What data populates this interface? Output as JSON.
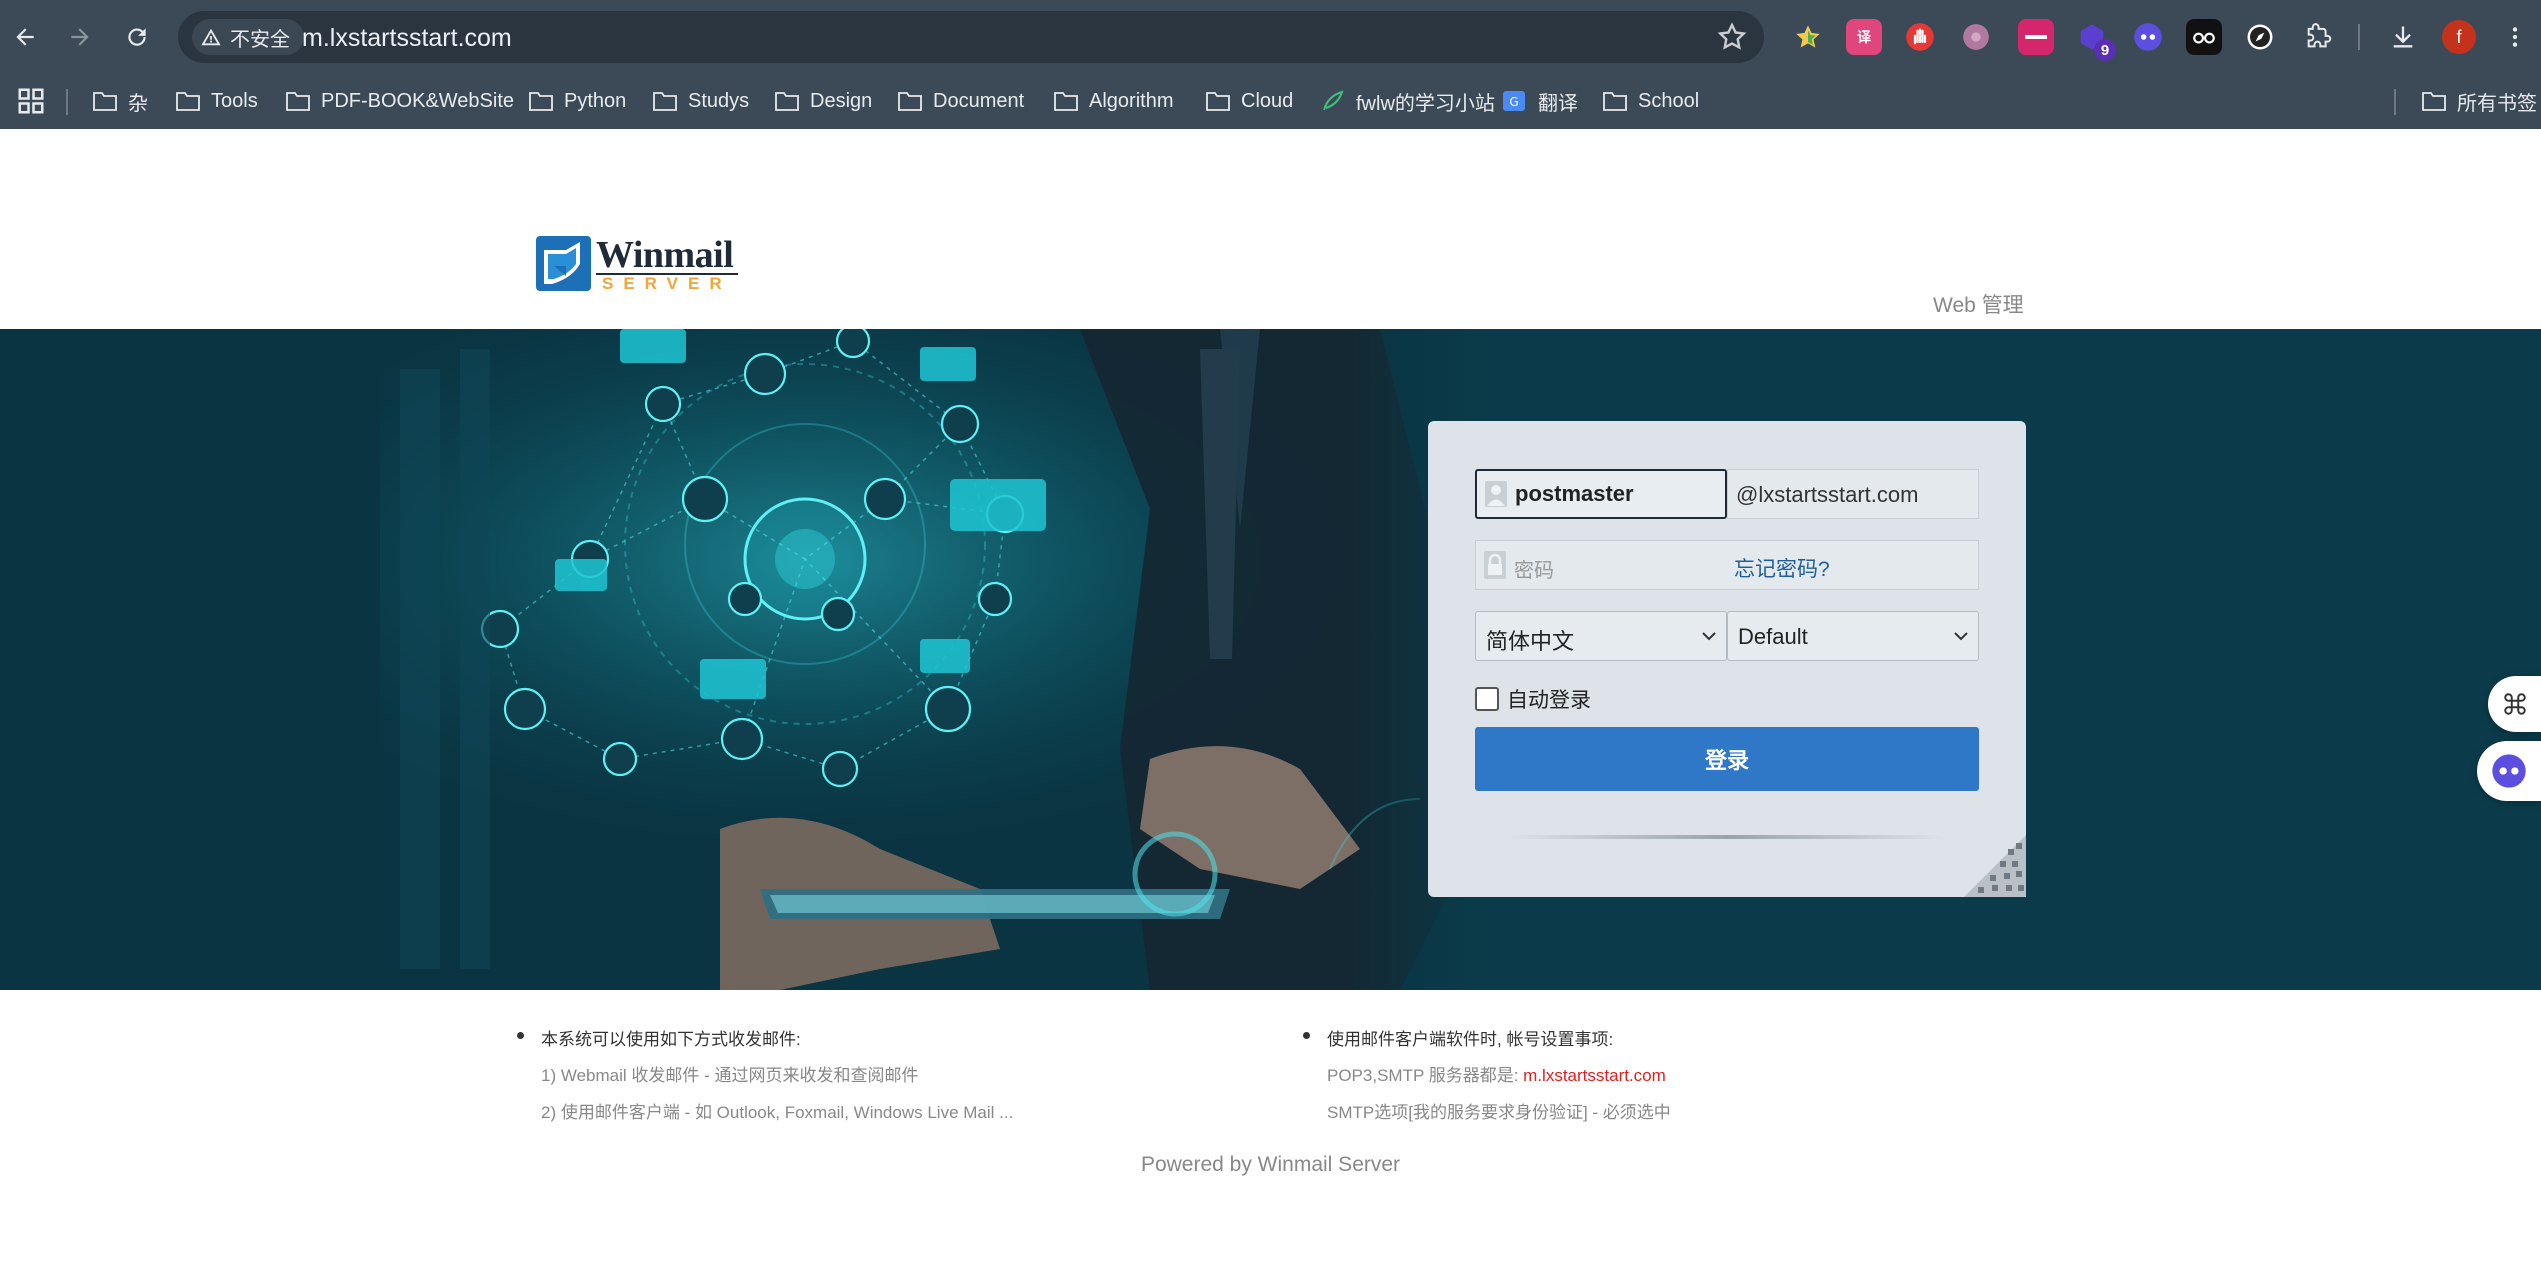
{
  "browser": {
    "security_label": "不安全",
    "url": "m.lxstartsstart.com",
    "profile_initial": "f",
    "extension_badge": "9"
  },
  "bookmarks": [
    {
      "label": "杂",
      "icon": "folder-icon"
    },
    {
      "label": "Tools",
      "icon": "folder-icon"
    },
    {
      "label": "PDF-BOOK&WebSite",
      "icon": "folder-icon"
    },
    {
      "label": "Python",
      "icon": "folder-icon"
    },
    {
      "label": "Studys",
      "icon": "folder-icon"
    },
    {
      "label": "Design",
      "icon": "folder-icon"
    },
    {
      "label": "Document",
      "icon": "folder-icon"
    },
    {
      "label": "Algorithm",
      "icon": "folder-icon"
    },
    {
      "label": "Cloud",
      "icon": "folder-icon"
    },
    {
      "label": "fwlw的学习小站",
      "icon": "feather-icon"
    },
    {
      "label": "翻译",
      "icon": "translate-icon"
    },
    {
      "label": "School",
      "icon": "folder-icon"
    }
  ],
  "all_bookmarks_label": "所有书签",
  "header": {
    "logo_word": "Winmail",
    "logo_sub": "SERVER",
    "web_admin_label": "Web 管理"
  },
  "login": {
    "username_value": "postmaster",
    "domain_suffix": "@lxstartsstart.com",
    "password_placeholder": "密码",
    "forgot_password_label": "忘记密码?",
    "language_selected": "简体中文",
    "skin_selected": "Default",
    "auto_login_label": "自动登录",
    "auto_login_checked": false,
    "submit_label": "登录"
  },
  "info": {
    "left_heading": "本系统可以使用如下方式收发邮件:",
    "left_lines": [
      "1) Webmail 收发邮件 - 通过网页来收发和查阅邮件",
      "2) 使用邮件客户端 - 如 Outlook, Foxmail, Windows Live Mail ..."
    ],
    "right_heading": "使用邮件客户端软件时, 帐号设置事项:",
    "right_server_prefix": "POP3,SMTP 服务器都是: ",
    "right_server_host": "m.lxstartsstart.com",
    "right_smtp_note": "SMTP选项[我的服务要求身份验证] - 必须选中"
  },
  "footer": {
    "powered_by": "Powered by Winmail Server"
  },
  "colors": {
    "chrome_bg": "#3c4a57",
    "banner_bg": "#0b3b4a",
    "login_button": "#2f78c8",
    "link_blue": "#1f5f99",
    "host_red": "#e02020"
  }
}
